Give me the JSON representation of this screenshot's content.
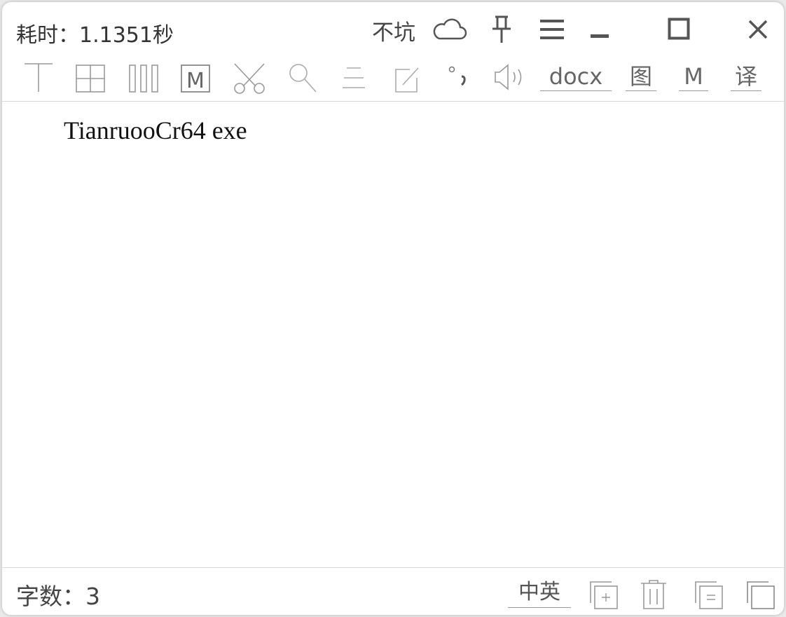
{
  "titlebar": {
    "elapsed_label": "耗时：1.1351秒",
    "no_pit_label": "不坑"
  },
  "toolbar": {
    "docx_label": "docx",
    "image_label": "图",
    "markdown_label": "M",
    "translate_label": "译"
  },
  "content": {
    "ocr_text": "TianruooCr64 exe"
  },
  "statusbar": {
    "word_count_label": "字数：3",
    "lang_label": "中英"
  },
  "icons": {
    "cloud": "cloud-icon",
    "pin": "pin-icon",
    "menu": "menu-icon",
    "minimize": "minimize-icon",
    "maximize": "maximize-icon",
    "close": "close-icon",
    "text_layout": "text-layout-icon",
    "grid": "grid-icon",
    "columns": "columns-icon",
    "markdown_box": "markdown-box-icon",
    "cut": "cut-icon",
    "search": "search-icon",
    "align": "align-icon",
    "edit": "edit-icon",
    "punctuation": "punctuation-icon",
    "speaker": "speaker-icon",
    "copy_add": "copy-add-icon",
    "trash": "trash-icon",
    "copy_equal": "copy-equal-icon",
    "copy": "copy-icon"
  }
}
